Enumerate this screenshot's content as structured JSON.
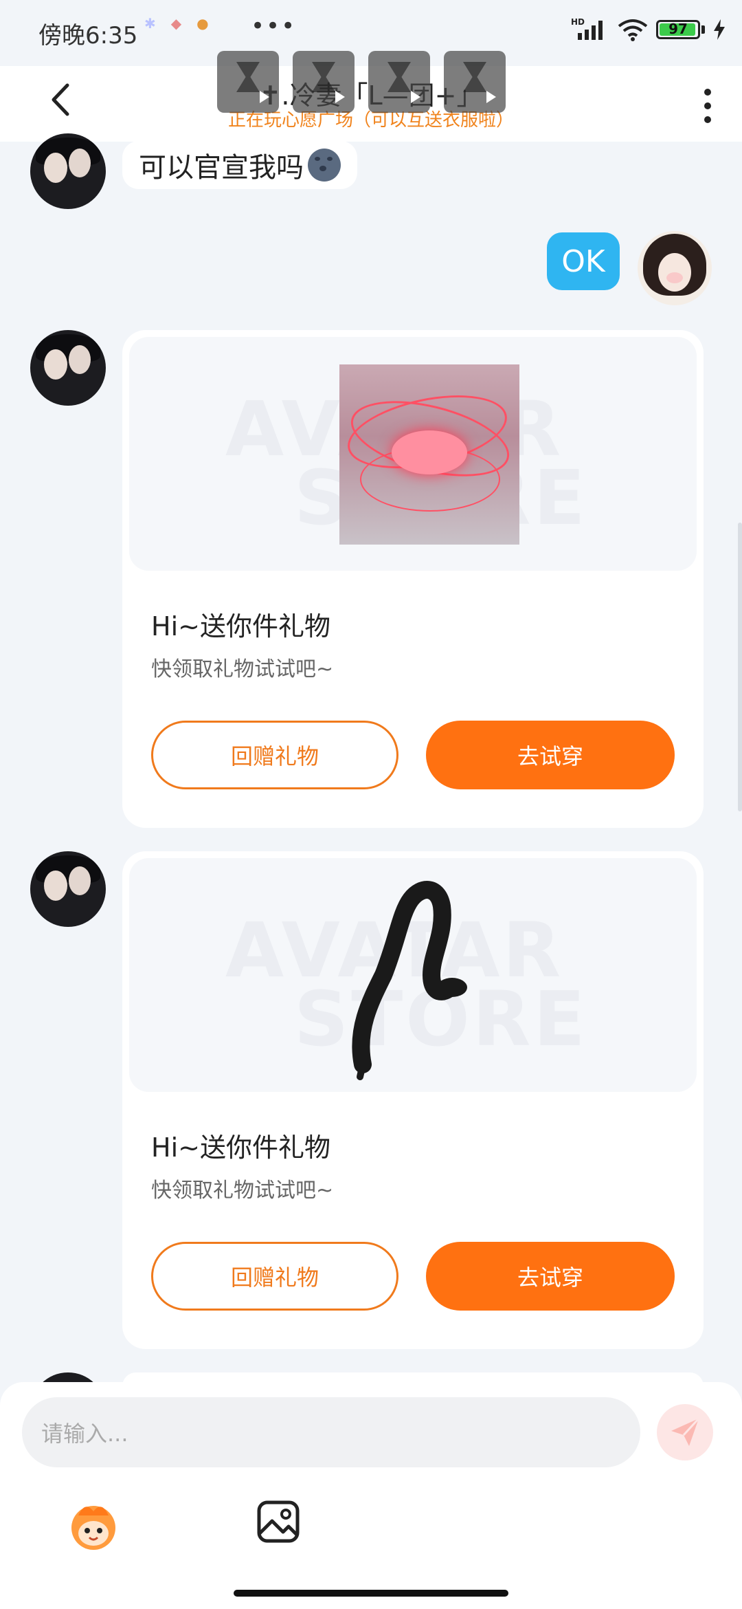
{
  "status_bar": {
    "time": "傍晚6:35",
    "more": "•••",
    "network": "HD",
    "battery": "97",
    "battery_level": 0.97
  },
  "header": {
    "title": "✝.冷妻「L—团+」",
    "subtitle": "正在玩心愿广场（可以互送衣服啦）"
  },
  "messages": {
    "friend_text": "可以官宣我吗",
    "my_text": "OK"
  },
  "gift_cards": [
    {
      "watermark_line1": "AVATAR",
      "watermark_line2": "STORE",
      "title": "Hi~送你件礼物",
      "subtitle": "快领取礼物试试吧~",
      "return_label": "回赠礼物",
      "try_label": "去试穿"
    },
    {
      "watermark_line1": "AVATAR",
      "watermark_line2": "STORE",
      "title": "Hi~送你件礼物",
      "subtitle": "快领取礼物试试吧~",
      "return_label": "回赠礼物",
      "try_label": "去试穿"
    }
  ],
  "input": {
    "placeholder": "请输入..."
  },
  "colors": {
    "accent_orange": "#ff7111",
    "bubble_blue": "#2fb5f1",
    "subtitle_orange": "#f0831c"
  },
  "icons": {
    "back": "chevron-left-icon",
    "more": "more-vertical-icon",
    "send": "send-icon",
    "emoji": "emoji-icon",
    "image": "image-icon"
  }
}
